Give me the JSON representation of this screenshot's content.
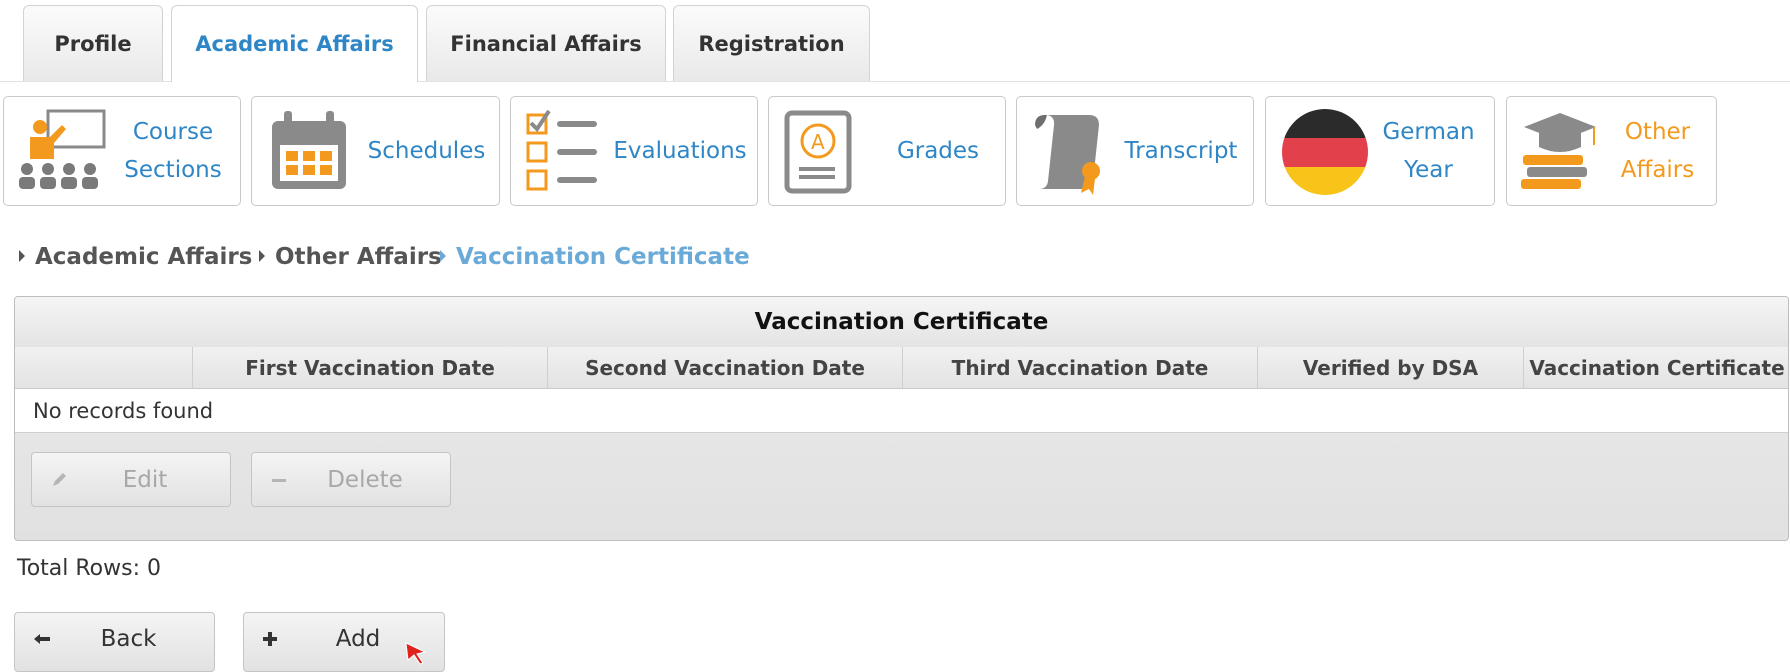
{
  "tabs": [
    {
      "label": "Profile",
      "active": false
    },
    {
      "label": "Academic Affairs",
      "active": true
    },
    {
      "label": "Financial Affairs",
      "active": false
    },
    {
      "label": "Registration",
      "active": false
    }
  ],
  "modules": [
    {
      "label_line1": "Course",
      "label_line2": "Sections",
      "icon": "presentation-icon"
    },
    {
      "label": "Schedules",
      "icon": "calendar-icon"
    },
    {
      "label": "Evaluations",
      "icon": "checklist-icon"
    },
    {
      "label": "Grades",
      "icon": "grades-icon"
    },
    {
      "label": "Transcript",
      "icon": "scroll-certificate-icon"
    },
    {
      "label_line1": "German",
      "label_line2": "Year",
      "icon": "german-flag-icon"
    },
    {
      "label_line1": "Other",
      "label_line2": "Affairs",
      "icon": "graduation-books-icon"
    }
  ],
  "breadcrumb": [
    "Academic Affairs",
    "Other Affairs",
    "Vaccination Certificate"
  ],
  "table": {
    "title": "Vaccination Certificate",
    "columns": [
      "",
      "First Vaccination Date",
      "Second Vaccination Date",
      "Third Vaccination Date",
      "Verified by DSA",
      "Vaccination Certificate"
    ],
    "empty_message": "No records found"
  },
  "actions": {
    "edit": "Edit",
    "delete": "Delete"
  },
  "total_rows": "Total Rows: 0",
  "footer": {
    "back": "Back",
    "add": "Add"
  },
  "colors": {
    "accent": "#2f86c6",
    "orange": "#f39a1e",
    "breadcrumb_current": "#6aaad8"
  }
}
